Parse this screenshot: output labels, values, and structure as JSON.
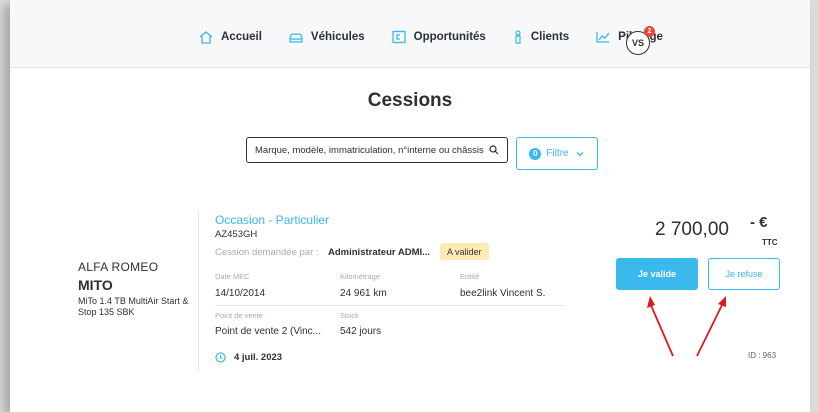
{
  "nav": {
    "items": [
      {
        "label": "Accueil",
        "icon": "home-icon"
      },
      {
        "label": "Véhicules",
        "icon": "car-icon"
      },
      {
        "label": "Opportunités",
        "icon": "opportunity-icon"
      },
      {
        "label": "Clients",
        "icon": "client-icon"
      },
      {
        "label": "Pilotage",
        "icon": "chart-icon"
      }
    ],
    "avatar": "VS",
    "notification_count": "2"
  },
  "page": {
    "title": "Cessions"
  },
  "search": {
    "value": "Marque, modèle, immatriculation, n°interne ou châssis"
  },
  "filter": {
    "label": "Filtre",
    "count": "0"
  },
  "vehicle": {
    "brand": "ALFA ROMEO",
    "model": "MITO",
    "version": "MiTo 1.4 TB MultiAir Start & Stop 135 SBK",
    "type": "Occasion - Particulier",
    "plate": "AZ453GH",
    "cession_label": "Cession demandée par :",
    "cession_requester": "Administrateur ADMI...",
    "status": "A valider",
    "date_mec_label": "Date MEC",
    "date_mec": "14/10/2014",
    "km_label": "Kilométrage",
    "km": "24 961 km",
    "entity_label": "Entité",
    "entity": "bee2link Vincent S.",
    "pdv_label": "Point de vente",
    "pdv": "Point de vente 2 (Vinc...",
    "stock_label": "Stock",
    "stock": "542 jours",
    "date": "4 juil. 2023",
    "price": "2 700,00",
    "currency": "- €",
    "ttc": "TTC",
    "validate_label": "Je valide",
    "refuse_label": "Je refuse",
    "id": "ID : 963"
  },
  "colors": {
    "accent": "#39b9ec",
    "badge": "#fcecb2",
    "arrow": "#e0191c",
    "notification": "#e8473d"
  }
}
